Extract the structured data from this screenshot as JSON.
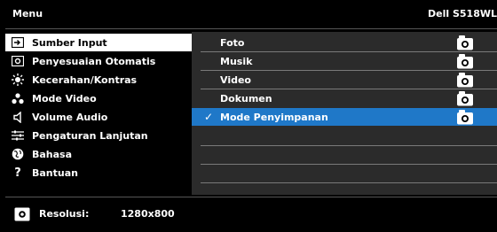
{
  "header": {
    "menu_title": "Menu",
    "model": "Dell S518WL"
  },
  "sidebar": {
    "items": [
      {
        "label": "Sumber Input",
        "icon": "input-source-icon",
        "active": true
      },
      {
        "label": "Penyesuaian Otomatis",
        "icon": "auto-adjust-icon",
        "active": false
      },
      {
        "label": "Kecerahan/Kontras",
        "icon": "brightness-icon",
        "active": false
      },
      {
        "label": "Mode Video",
        "icon": "video-mode-icon",
        "active": false
      },
      {
        "label": "Volume Audio",
        "icon": "speaker-icon",
        "active": false
      },
      {
        "label": "Pengaturan Lanjutan",
        "icon": "advanced-settings-icon",
        "active": false
      },
      {
        "label": "Bahasa",
        "icon": "globe-icon",
        "active": false
      },
      {
        "label": "Bantuan",
        "icon": "help-icon",
        "active": false
      }
    ]
  },
  "submenu": {
    "items": [
      {
        "label": "Foto",
        "selected": false,
        "icon": "lock-icon"
      },
      {
        "label": "Musik",
        "selected": false,
        "icon": "lock-icon"
      },
      {
        "label": "Video",
        "selected": false,
        "icon": "lock-icon"
      },
      {
        "label": "Dokumen",
        "selected": false,
        "icon": "lock-icon"
      },
      {
        "label": "Mode Penyimpanan",
        "selected": true,
        "icon": "lock-icon"
      }
    ],
    "check_mark": "✓"
  },
  "footer": {
    "resolution_label": "Resolusi:",
    "resolution_value": "1280x800"
  },
  "colors": {
    "background": "#000000",
    "panel": "#2b2b2b",
    "highlight": "#1f78c8",
    "active_item": "#ffffff"
  }
}
